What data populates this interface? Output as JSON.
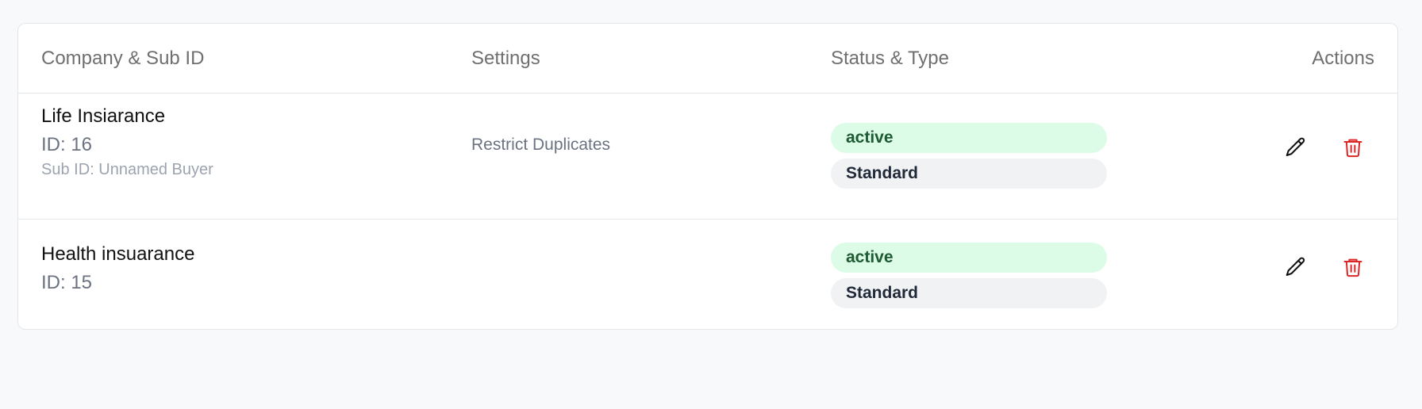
{
  "table": {
    "headers": {
      "company": "Company & Sub ID",
      "settings": "Settings",
      "status": "Status & Type",
      "actions": "Actions"
    },
    "rows": [
      {
        "company_name": "Life Insiarance",
        "id_text": "ID: 16",
        "sub_id_text": "Sub ID: Unnamed Buyer",
        "settings": "Restrict Duplicates",
        "status": "active",
        "type": "Standard"
      },
      {
        "company_name": "Health insuarance",
        "id_text": "ID: 15",
        "sub_id_text": "",
        "settings": "",
        "status": "active",
        "type": "Standard"
      }
    ]
  },
  "icons": {
    "edit": "pencil-icon",
    "delete": "trash-icon"
  },
  "colors": {
    "page_background": "#f8f9fb",
    "card_border": "#e4e6ea",
    "active_badge_bg": "#dcfce7",
    "active_badge_text": "#1e5a32",
    "type_badge_bg": "#f1f2f4",
    "delete_icon": "#dc2626"
  }
}
